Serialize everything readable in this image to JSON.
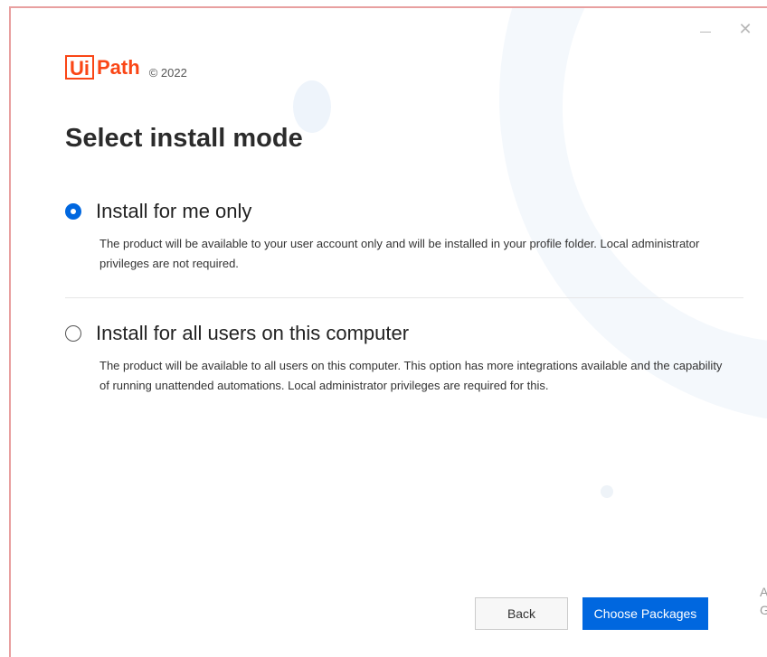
{
  "window": {
    "close_glyph": "✕"
  },
  "header": {
    "logo_box_text": "Ui",
    "logo_text": "Path",
    "copyright": "© 2022"
  },
  "main": {
    "title": "Select install mode",
    "options": [
      {
        "label": "Install for me only",
        "description": "The product will be available to your user account only and will be installed in your profile folder. Local administrator privileges are not required.",
        "selected": true
      },
      {
        "label": "Install for all users on this computer",
        "description": "The product will be available to all users on this computer. This option has more integrations available and the capability of running unattended automations. Local administrator privileges are required for this.",
        "selected": false
      }
    ]
  },
  "footer": {
    "back_label": "Back",
    "next_label": "Choose Packages"
  },
  "edge": {
    "glyph_a": "A",
    "glyph_b": "G"
  },
  "colors": {
    "brand": "#fa4616",
    "accent": "#0067df"
  },
  "icons": {
    "minimize": "minimize-icon",
    "close": "close-icon",
    "radio_checked": "radio-checked-icon",
    "radio_unchecked": "radio-unchecked-icon"
  }
}
